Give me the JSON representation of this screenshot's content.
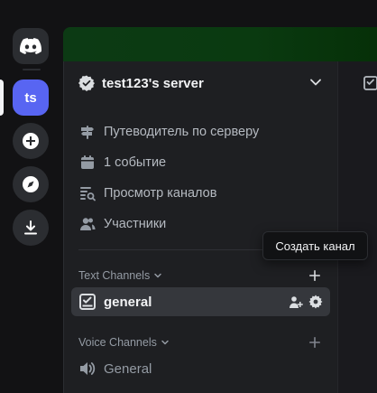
{
  "rail": {
    "server_abbr": "ts",
    "icons": [
      "discord-logo-icon",
      "add-server-icon",
      "explore-icon",
      "download-icon"
    ]
  },
  "server": {
    "name": "test123's server"
  },
  "nav": {
    "guide": "Путеводитель по серверу",
    "events": "1 событие",
    "browse_channels": "Просмотр каналов",
    "members": "Участники"
  },
  "categories": {
    "text": "Text Channels",
    "voice": "Voice Channels"
  },
  "channels": {
    "text": [
      {
        "name": "general"
      }
    ],
    "voice": [
      {
        "name": "General"
      }
    ]
  },
  "tooltip": {
    "text": "Создать канал"
  },
  "colors": {
    "accent": "#5865f2",
    "banner_green": "#0c3a14",
    "sidebar_bg": "#1e1f22",
    "rail_bg": "#121214"
  }
}
